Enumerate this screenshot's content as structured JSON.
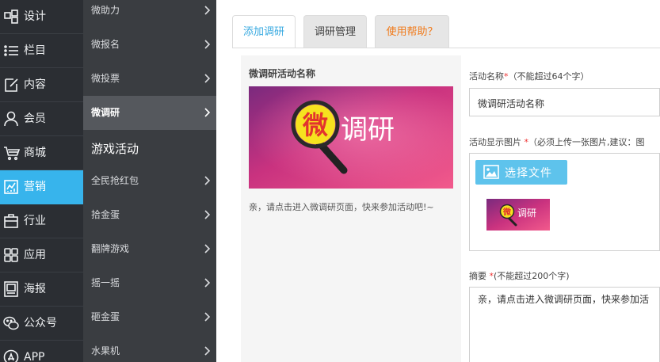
{
  "nav_primary": [
    {
      "label": "设计",
      "icon": "design-icon",
      "active": false
    },
    {
      "label": "栏目",
      "icon": "list-icon",
      "active": false
    },
    {
      "label": "内容",
      "icon": "edit-icon",
      "active": false
    },
    {
      "label": "会员",
      "icon": "user-icon",
      "active": false
    },
    {
      "label": "商城",
      "icon": "cart-icon",
      "active": false
    },
    {
      "label": "营销",
      "icon": "chart-icon",
      "active": true
    },
    {
      "label": "行业",
      "icon": "briefcase-icon",
      "active": false
    },
    {
      "label": "应用",
      "icon": "apps-icon",
      "active": false
    },
    {
      "label": "海报",
      "icon": "poster-icon",
      "active": false
    },
    {
      "label": "公众号",
      "icon": "wechat-icon",
      "active": false
    },
    {
      "label": "APP",
      "icon": "app-store-icon",
      "active": false
    }
  ],
  "nav_secondary": {
    "items_top": [
      {
        "label": "微助力",
        "active": false
      },
      {
        "label": "微报名",
        "active": false
      },
      {
        "label": "微投票",
        "active": false
      },
      {
        "label": "微调研",
        "active": true
      }
    ],
    "group_title": "游戏活动",
    "items_game": [
      {
        "label": "全民抢红包"
      },
      {
        "label": "拾金蛋"
      },
      {
        "label": "翻牌游戏"
      },
      {
        "label": "摇一摇"
      },
      {
        "label": "砸金蛋"
      },
      {
        "label": "水果机"
      }
    ]
  },
  "tabs": [
    {
      "label": "添加调研",
      "active": true
    },
    {
      "label": "调研管理",
      "active": false
    },
    {
      "label": "使用帮助？",
      "active": false
    }
  ],
  "preview": {
    "title": "微调研活动名称",
    "banner_seal_char": "微",
    "banner_text": "调研",
    "description": "亲，请点击进入微调研页面，快来参加活动吧!~"
  },
  "form": {
    "name_label": "活动名称",
    "name_hint": "（不能超过64个字）",
    "name_value": "微调研活动名称",
    "image_label": "活动显示图片",
    "image_hint": "（必须上传一张图片,建议：图",
    "upload_button": "选择文件",
    "summary_label": "摘要",
    "summary_hint": "(不能超过200个字)",
    "summary_value": "亲，请点击进入微调研页面，快来参加活"
  },
  "colors": {
    "sidebar_bg": "#2b2e33",
    "subnav_bg": "#3a3d41",
    "accent": "#37b4ec",
    "help_orange": "#f07a1a",
    "required_red": "#e33333"
  }
}
